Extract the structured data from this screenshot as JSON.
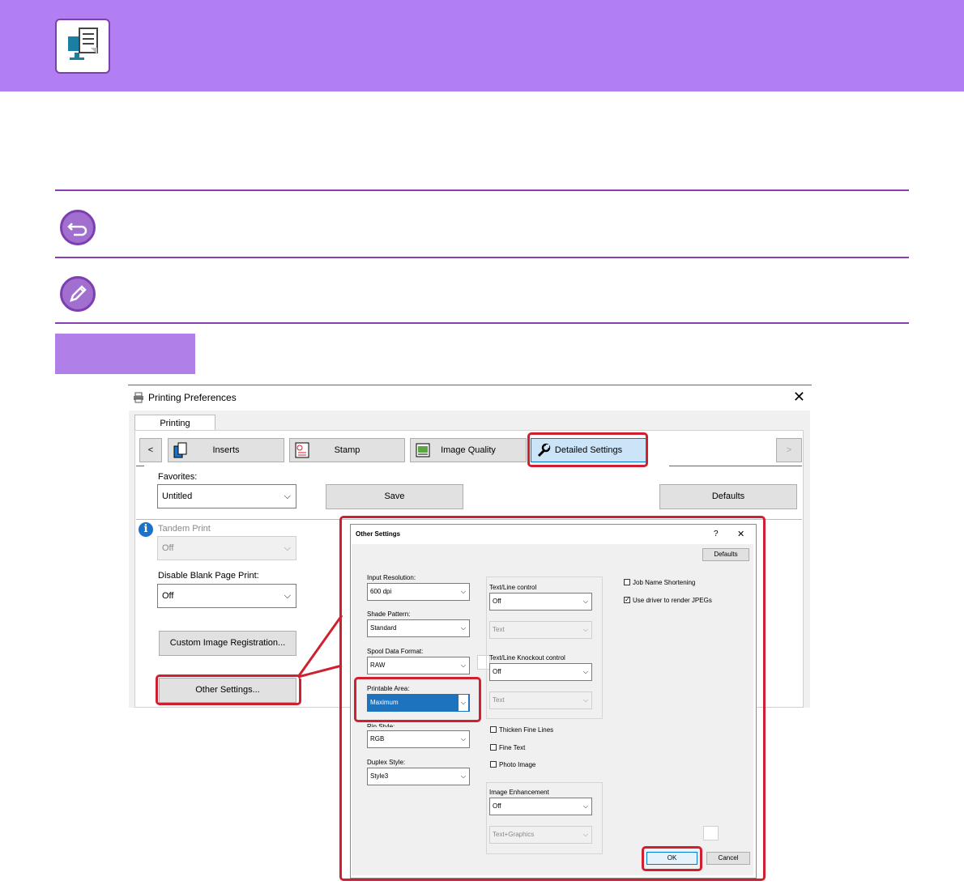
{
  "window": {
    "title": "Printing Preferences",
    "close_glyph": "✕",
    "tab": "Printing Preferences"
  },
  "toolbar": {
    "prev": "<",
    "next": ">",
    "tabs": [
      "Inserts",
      "Stamp",
      "Image Quality",
      "Detailed Settings"
    ]
  },
  "favorites": {
    "label": "Favorites:",
    "value": "Untitled",
    "save": "Save",
    "defaults": "Defaults"
  },
  "tandem": {
    "label": "Tandem Print",
    "value": "Off"
  },
  "disable_blank": {
    "label": "Disable Blank Page Print:",
    "value": "Off"
  },
  "buttons": {
    "custom_image": "Custom Image Registration...",
    "other_settings": "Other Settings..."
  },
  "dialog": {
    "title": "Other Settings",
    "help": "?",
    "close": "✕",
    "defaults": "Defaults",
    "input_resolution": {
      "label": "Input Resolution:",
      "value": "600 dpi"
    },
    "shade_pattern": {
      "label": "Shade Pattern:",
      "value": "Standard"
    },
    "spool_format": {
      "label": "Spool Data Format:",
      "value": "RAW"
    },
    "printable_area": {
      "label": "Printable Area:",
      "value": "Maximum"
    },
    "rip_style": {
      "label": "Rip Style:",
      "value": "RGB"
    },
    "duplex_style": {
      "label": "Duplex Style:",
      "value": "Style3"
    },
    "text_line_control": {
      "label": "Text/Line control",
      "value": "Off",
      "sub": "Text"
    },
    "knockout_control": {
      "label": "Text/Line Knockout control",
      "value": "Off",
      "sub": "Text"
    },
    "checks": {
      "thicken": "Thicken Fine Lines",
      "fine_text": "Fine Text",
      "photo_image": "Photo Image"
    },
    "image_enhancement": {
      "label": "Image Enhancement",
      "value": "Off",
      "sub": "Text+Graphics"
    },
    "job_name_shortening": "Job Name Shortening",
    "use_driver_jpeg": "Use driver to render JPEGs",
    "check_mark": "✓",
    "ok": "OK",
    "cancel": "Cancel"
  },
  "chevron": "⌵",
  "colors": {
    "header": "#b17ff2",
    "accent_red": "#d0202f",
    "rule": "#8a3fb0"
  }
}
